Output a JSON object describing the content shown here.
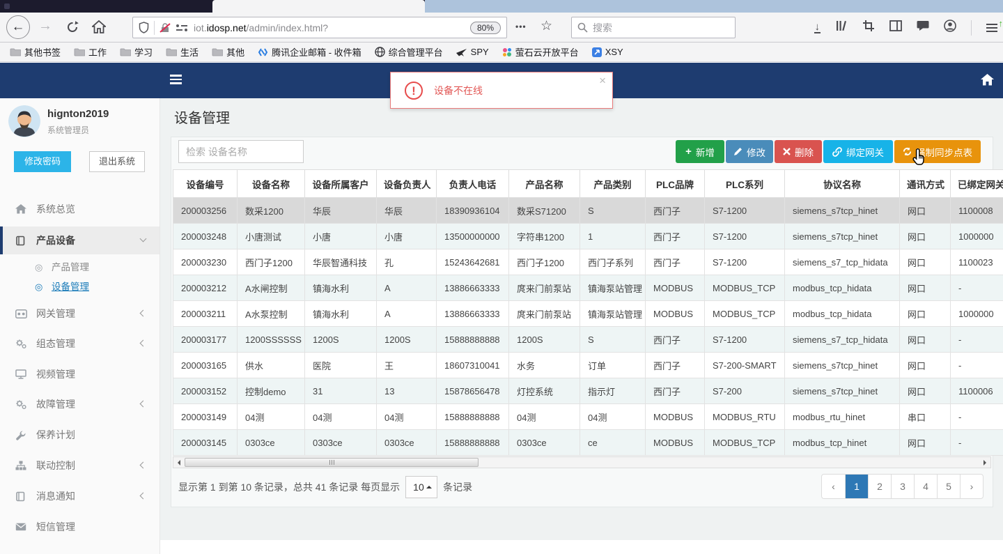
{
  "browser": {
    "url_prefix": "iot.",
    "url_domain": "idosp.net",
    "url_path": "/admin/index.html?",
    "zoom_badge": "80%",
    "search_placeholder": "搜索",
    "bookmarks": [
      {
        "label": "其他书签",
        "icon": "folder-icon"
      },
      {
        "label": "工作",
        "icon": "folder-icon"
      },
      {
        "label": "学习",
        "icon": "folder-icon"
      },
      {
        "label": "生活",
        "icon": "folder-icon"
      },
      {
        "label": "其他",
        "icon": "folder-icon"
      },
      {
        "label": "腾讯企业邮箱 - 收件箱",
        "icon": "tencent-mail-icon"
      },
      {
        "label": "综合管理平台",
        "icon": "globe-icon"
      },
      {
        "label": "SPY",
        "icon": "plane-icon"
      },
      {
        "label": "萤石云开放平台",
        "icon": "color-dots-icon"
      },
      {
        "label": "XSY",
        "icon": "arrow-square-icon"
      }
    ]
  },
  "icons": {
    "back_arrow": "←",
    "forward_arrow": "→",
    "overflow_dots": "•••",
    "star": "☆",
    "download_arrow": "↓",
    "update_arrow": "↑",
    "target": "◎",
    "plus": "+",
    "close_x": "×",
    "prev": "‹",
    "next": "›",
    "xsy_arrow": "↗",
    "exclamation": "!"
  },
  "notification": {
    "message": "设备不在线"
  },
  "navbar": {},
  "sidebar": {
    "username": "hignton2019",
    "role": "系统管理员",
    "change_password": "修改密码",
    "logout": "退出系统",
    "menu": [
      {
        "label": "系统总览"
      },
      {
        "label": "产品设备",
        "expanded": true
      },
      {
        "label": "产品管理",
        "sub": true
      },
      {
        "label": "设备管理",
        "sub": true,
        "active": true
      },
      {
        "label": "网关管理",
        "collapsible": true
      },
      {
        "label": "组态管理",
        "collapsible": true
      },
      {
        "label": "视频管理"
      },
      {
        "label": "故障管理",
        "collapsible": true
      },
      {
        "label": "保养计划"
      },
      {
        "label": "联动控制",
        "collapsible": true
      },
      {
        "label": "消息通知",
        "collapsible": true
      },
      {
        "label": "短信管理"
      }
    ]
  },
  "page": {
    "title": "设备管理"
  },
  "toolbar": {
    "search_placeholder": "检索 设备名称",
    "buttons": [
      {
        "label": "新增",
        "color": "#22a049"
      },
      {
        "label": "修改",
        "color": "#4a8cba"
      },
      {
        "label": "删除",
        "color": "#d9534f"
      },
      {
        "label": "绑定网关",
        "color": "#17b3e8"
      },
      {
        "label": "强制同步点表",
        "color": "#e8930c"
      }
    ]
  },
  "table": {
    "headers": [
      "设备编号",
      "设备名称",
      "设备所属客户",
      "设备负责人",
      "负责人电话",
      "产品名称",
      "产品类别",
      "PLC品牌",
      "PLC系列",
      "协议名称",
      "通讯方式",
      "已绑定网关"
    ],
    "selected_row_index": 0,
    "rows": [
      [
        "200003256",
        "数采1200",
        "华辰",
        "华辰",
        "18390936104",
        "数采S71200",
        "S",
        "西门子",
        "S7-1200",
        "siemens_s7tcp_hinet",
        "网口",
        "1100008"
      ],
      [
        "200003248",
        "小唐测试",
        "小唐",
        "小唐",
        "13500000000",
        "字符串1200",
        "1",
        "西门子",
        "S7-1200",
        "siemens_s7tcp_hinet",
        "网口",
        "1000000"
      ],
      [
        "200003230",
        "西门子1200",
        "华辰智通科技",
        "孔",
        "15243642681",
        "西门子1200",
        "西门子系列",
        "西门子",
        "S7-1200",
        "siemens_s7_tcp_hidata",
        "网口",
        "1100023"
      ],
      [
        "200003212",
        "A水闸控制",
        "镇海水利",
        "A",
        "13886663333",
        "庹来门前泵站",
        "镇海泵站管理",
        "MODBUS",
        "MODBUS_TCP",
        "modbus_tcp_hidata",
        "网口",
        "-"
      ],
      [
        "200003211",
        "A水泵控制",
        "镇海水利",
        "A",
        "13886663333",
        "庹来门前泵站",
        "镇海泵站管理",
        "MODBUS",
        "MODBUS_TCP",
        "modbus_tcp_hidata",
        "网口",
        "1000000"
      ],
      [
        "200003177",
        "1200SSSSSS",
        "1200S",
        "1200S",
        "15888888888",
        "1200S",
        "S",
        "西门子",
        "S7-1200",
        "siemens_s7_tcp_hidata",
        "网口",
        "-"
      ],
      [
        "200003165",
        "供水",
        "医院",
        "王",
        "18607310041",
        "水务",
        "订单",
        "西门子",
        "S7-200-SMART",
        "siemens_s7tcp_hinet",
        "网口",
        "-"
      ],
      [
        "200003152",
        "控制demo",
        "31",
        "13",
        "15878656478",
        "灯控系统",
        "指示灯",
        "西门子",
        "S7-200",
        "siemens_s7tcp_hinet",
        "网口",
        "1100006"
      ],
      [
        "200003149",
        "04测",
        "04测",
        "04测",
        "15888888888",
        "04测",
        "04测",
        "MODBUS",
        "MODBUS_RTU",
        "modbus_rtu_hinet",
        "串口",
        "-"
      ],
      [
        "200003145",
        "0303ce",
        "0303ce",
        "0303ce",
        "15888888888",
        "0303ce",
        "ce",
        "MODBUS",
        "MODBUS_TCP",
        "modbus_tcp_hinet",
        "网口",
        "-"
      ]
    ]
  },
  "pagination": {
    "info_before": "显示第 1 到第 10 条记录，总共 41 条记录 每页显示",
    "page_size": "10",
    "info_after": "条记录",
    "pages": [
      "1",
      "2",
      "3",
      "4",
      "5"
    ],
    "active_page": "1"
  },
  "colors": {
    "navbar_blue": "#1e3c70",
    "accent_cyan": "#2cb4e8",
    "link_blue": "#1a7bb9",
    "active_page_blue": "#2e78b5",
    "notification_red": "#e25856",
    "btn_add_green": "#22a049",
    "btn_edit_blue": "#4a8cba",
    "btn_delete_red": "#d9534f",
    "btn_bind_cyan": "#17b3e8",
    "btn_sync_orange": "#e8930c"
  }
}
